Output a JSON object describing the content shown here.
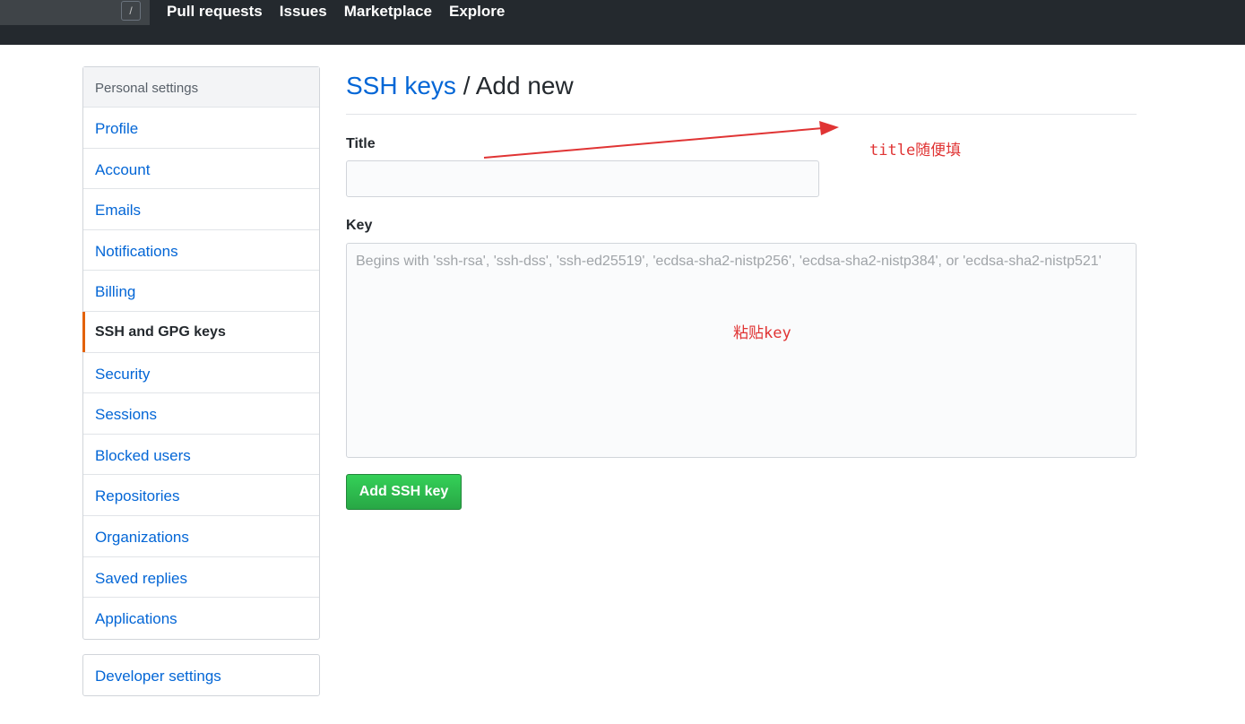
{
  "header": {
    "search_shortcut": "/",
    "nav": [
      "Pull requests",
      "Issues",
      "Marketplace",
      "Explore"
    ]
  },
  "sidebar": {
    "heading": "Personal settings",
    "items": [
      "Profile",
      "Account",
      "Emails",
      "Notifications",
      "Billing",
      "SSH and GPG keys",
      "Security",
      "Sessions",
      "Blocked users",
      "Repositories",
      "Organizations",
      "Saved replies",
      "Applications"
    ],
    "selected": "SSH and GPG keys",
    "developer": "Developer settings"
  },
  "main": {
    "crumb": "SSH keys",
    "separator": " / ",
    "title": "Add new",
    "title_label": "Title",
    "title_value": "",
    "key_label": "Key",
    "key_placeholder": "Begins with 'ssh-rsa', 'ssh-dss', 'ssh-ed25519', 'ecdsa-sha2-nistp256', 'ecdsa-sha2-nistp384', or 'ecdsa-sha2-nistp521'",
    "submit": "Add SSH key"
  },
  "annotations": {
    "title_note": "title随便填",
    "key_note": "粘贴key",
    "color": "#e03434"
  }
}
